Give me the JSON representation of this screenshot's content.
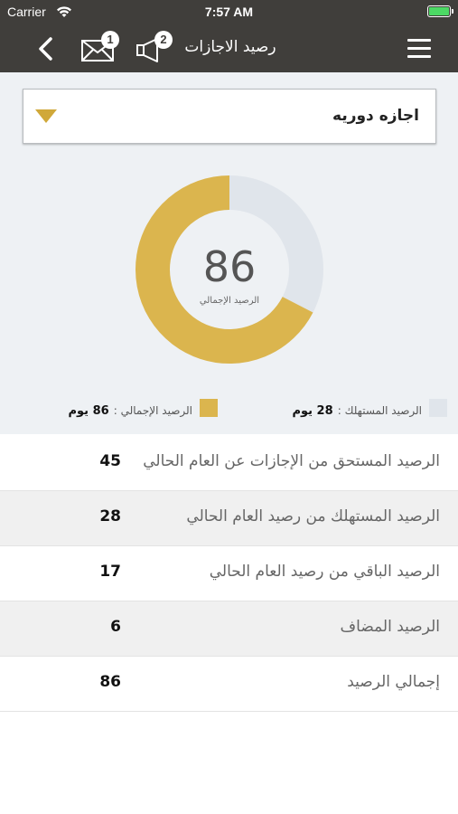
{
  "status_bar": {
    "carrier": "Carrier",
    "time": "7:57 AM"
  },
  "nav": {
    "title": "رصيد الاجازات",
    "mail_badge": "1",
    "announcement_badge": "2"
  },
  "leave_type": {
    "selected": "اجازه دوريه"
  },
  "chart_data": {
    "type": "pie",
    "title": "",
    "center_value": "86",
    "center_label": "الرصيد الإجمالي",
    "total": 86,
    "consumed": 28,
    "colors": {
      "total": "#dbb54e",
      "consumed": "#e0e5eb"
    }
  },
  "legend": {
    "consumed_label": "الرصيد المستهلك :",
    "consumed_value": "28 يوم",
    "total_label": "الرصيد الإجمالي :",
    "total_value": "86 يوم"
  },
  "rows": [
    {
      "label": "الرصيد المستحق من الإجازات عن العام الحالي",
      "value": "45"
    },
    {
      "label": "الرصيد المستهلك من رصيد العام الحالي",
      "value": "28"
    },
    {
      "label": "الرصيد الباقي من رصيد العام الحالي",
      "value": "17"
    },
    {
      "label": "الرصيد المضاف",
      "value": "6"
    },
    {
      "label": "إجمالي الرصيد",
      "value": "86"
    }
  ]
}
